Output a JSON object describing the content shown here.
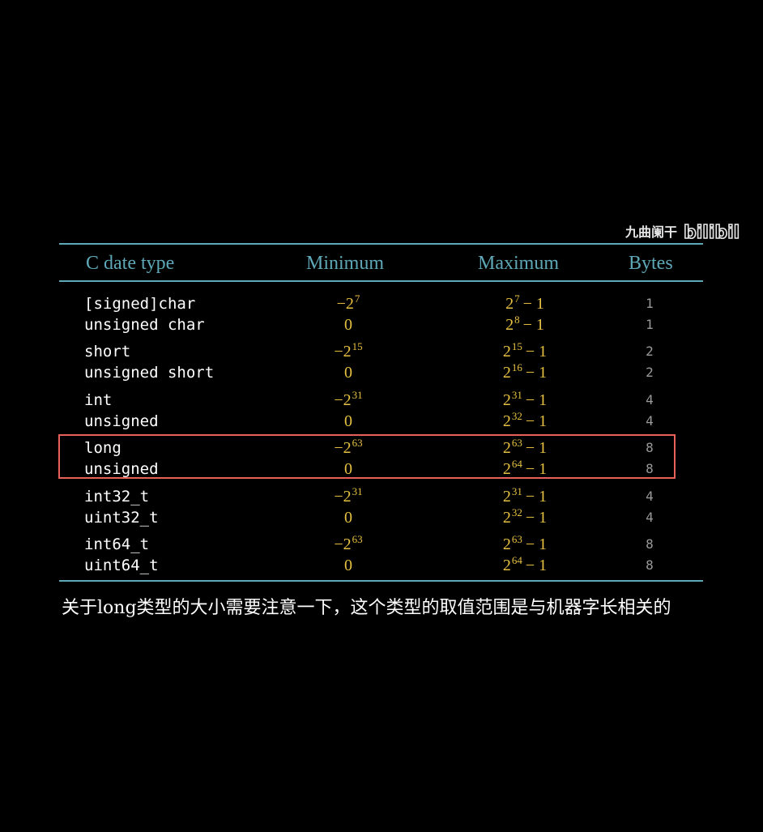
{
  "watermark": {
    "name": "九曲阑干",
    "logo_text": "bilibili"
  },
  "table": {
    "headers": {
      "type": "C date type",
      "min": "Minimum",
      "max": "Maximum",
      "bytes": "Bytes"
    },
    "rows": [
      {
        "type": "[signed]char",
        "min_sign": "−",
        "min_base": "2",
        "min_exp": "7",
        "max_base": "2",
        "max_exp": "7",
        "max_tail": "− 1",
        "bytes": "1"
      },
      {
        "type": "unsigned char",
        "min_zero": "0",
        "max_base": "2",
        "max_exp": "8",
        "max_tail": "− 1",
        "bytes": "1"
      },
      {
        "type": "short",
        "min_sign": "−",
        "min_base": "2",
        "min_exp": "15",
        "max_base": "2",
        "max_exp": "15",
        "max_tail": "− 1",
        "bytes": "2"
      },
      {
        "type": "unsigned short",
        "min_zero": "0",
        "max_base": "2",
        "max_exp": "16",
        "max_tail": "− 1",
        "bytes": "2"
      },
      {
        "type": "int",
        "min_sign": "−",
        "min_base": "2",
        "min_exp": "31",
        "max_base": "2",
        "max_exp": "31",
        "max_tail": "− 1",
        "bytes": "4"
      },
      {
        "type": "unsigned",
        "min_zero": "0",
        "max_base": "2",
        "max_exp": "32",
        "max_tail": "− 1",
        "bytes": "4"
      },
      {
        "type": "long",
        "min_sign": "−",
        "min_base": "2",
        "min_exp": "63",
        "max_base": "2",
        "max_exp": "63",
        "max_tail": "− 1",
        "bytes": "8"
      },
      {
        "type": "unsigned",
        "min_zero": "0",
        "max_base": "2",
        "max_exp": "64",
        "max_tail": "− 1",
        "bytes": "8"
      },
      {
        "type": "int32_t",
        "min_sign": "−",
        "min_base": "2",
        "min_exp": "31",
        "max_base": "2",
        "max_exp": "31",
        "max_tail": "− 1",
        "bytes": "4"
      },
      {
        "type": "uint32_t",
        "min_zero": "0",
        "max_base": "2",
        "max_exp": "32",
        "max_tail": "− 1",
        "bytes": "4"
      },
      {
        "type": "int64_t",
        "min_sign": "−",
        "min_base": "2",
        "min_exp": "63",
        "max_base": "2",
        "max_exp": "63",
        "max_tail": "− 1",
        "bytes": "8"
      },
      {
        "type": "uint64_t",
        "min_zero": "0",
        "max_base": "2",
        "max_exp": "64",
        "max_tail": "− 1",
        "bytes": "8"
      }
    ]
  },
  "caption": "关于long类型的大小需要注意一下，这个类型的取值范围是与机器字长相关的",
  "colors": {
    "header": "#5fa8b8",
    "value": "#e6c040",
    "bytes": "#9a9a9a",
    "highlight": "#e8605a"
  }
}
